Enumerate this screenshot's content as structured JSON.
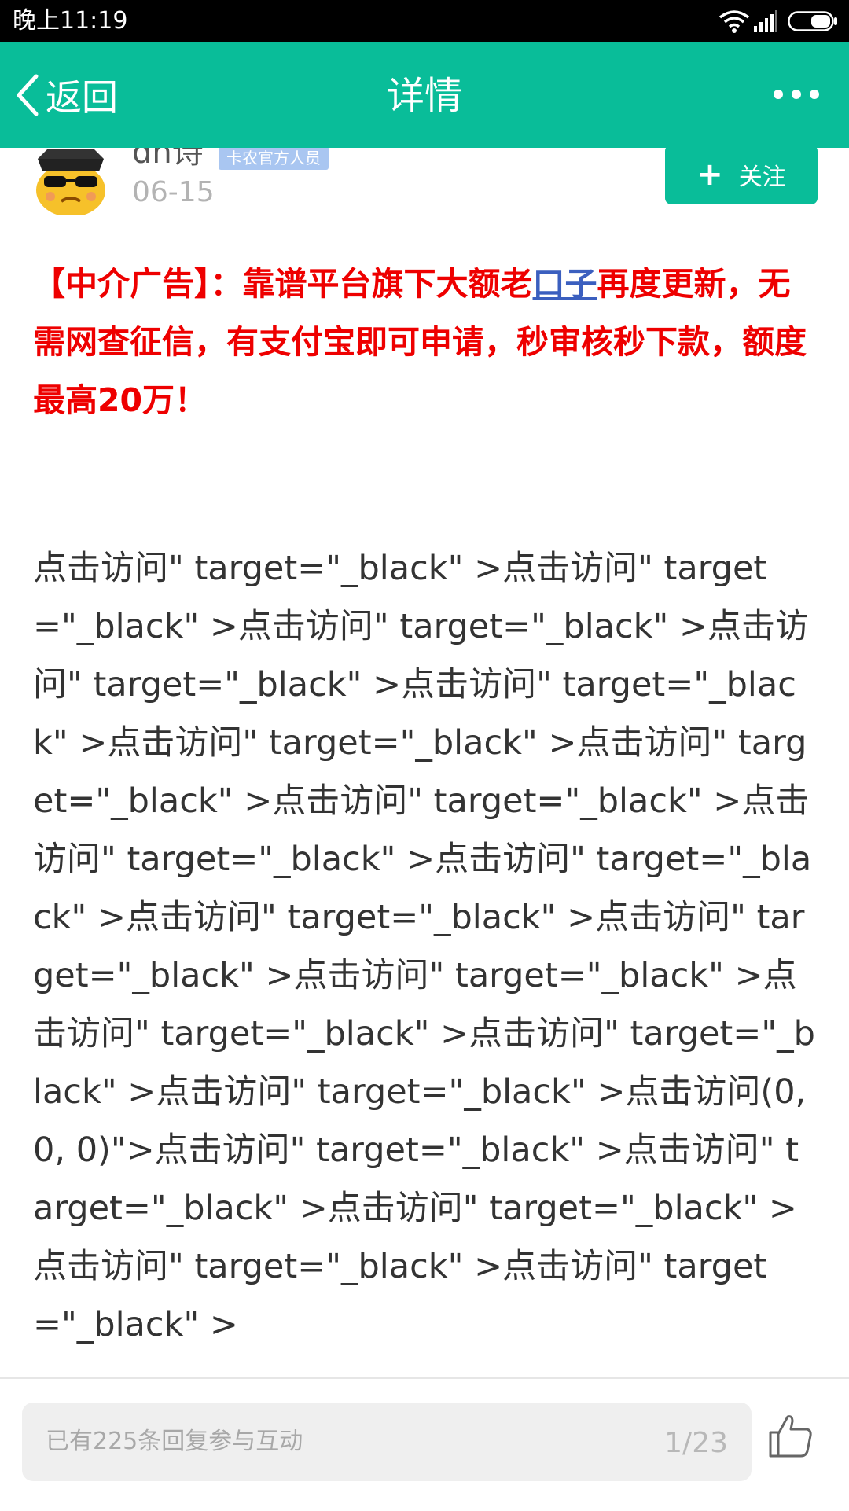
{
  "status_bar": {
    "time": "晚上11:19",
    "icons": [
      "wifi-icon",
      "signal-icon",
      "battery-icon"
    ]
  },
  "nav": {
    "back_label": "返回",
    "title": "详情",
    "more_icon": "more-dots-icon"
  },
  "author": {
    "name": "dh诗",
    "badge": "卡农官方人员",
    "date": "06-15",
    "follow_label": "关注"
  },
  "ad": {
    "before_link": "【中介广告】：靠谱平台旗下大额老",
    "link": "口子",
    "after_link": "再度更新，无需网查征信，有支付宝即可申请，秒审核秒下款，额度最高20万！"
  },
  "body_text": "点击访问\" target=\"_black\" >点击访问\" target=\"_black\" >点击访问\" target=\"_black\" >点击访问\" target=\"_black\" >点击访问\" target=\"_black\" >点击访问\" target=\"_black\" >点击访问\" target=\"_black\" >点击访问\" target=\"_black\" >点击访问\" target=\"_black\" >点击访问\" target=\"_black\" >点击访问\" target=\"_black\" >点击访问\" target=\"_black\" >点击访问\" target=\"_black\" >点击访问\" target=\"_black\" >点击访问\" target=\"_black\" >点击访问\" target=\"_black\" >点击访问(0, 0, 0)\">点击访问\" target=\"_black\" >点击访问\" target=\"_black\" >点击访问\" target=\"_black\" >点击访问\" target=\"_black\" >点击访问\" target=\"_black\" >",
  "bottom_bar": {
    "reply_placeholder": "已有225条回复参与互动",
    "page_indicator": "1/23",
    "like_icon": "thumbs-up-icon"
  },
  "colors": {
    "accent": "#09bd99",
    "ad_red": "#ee0000",
    "link_blue": "#3b5fbf",
    "badge_blue": "#a9c6f1"
  }
}
